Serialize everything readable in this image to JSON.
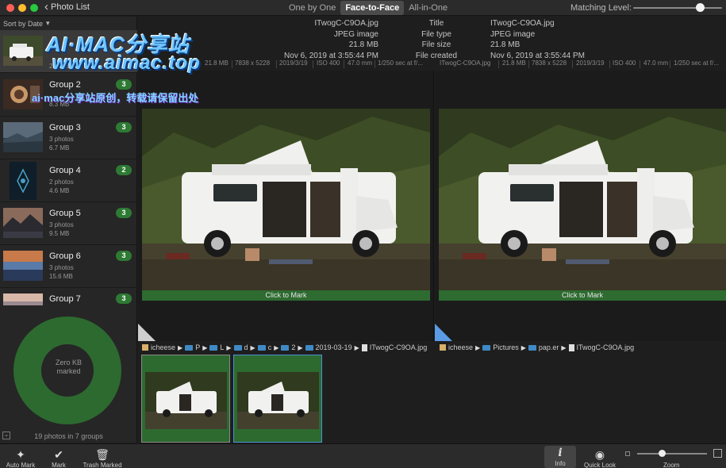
{
  "titlebar": {
    "back_label": "Photo List",
    "tabs": [
      "One by One",
      "Face-to-Face",
      "All-in-One"
    ],
    "active_tab": "Face-to-Face",
    "matching_label": "Matching Level:",
    "matching_level": 0.75,
    "traffic_colors": [
      "#fe5f57",
      "#febc2e",
      "#28c840"
    ]
  },
  "sidebar": {
    "sort_label": "Sort by Date",
    "groups": [
      {
        "name": "",
        "photos": "2 photos",
        "size": ""
      },
      {
        "name": "Group 2",
        "badge": "3",
        "photos": "",
        "size": "8.3 MB"
      },
      {
        "name": "Group 3",
        "badge": "3",
        "photos": "3 photos",
        "size": "6.7 MB"
      },
      {
        "name": "Group 4",
        "badge": "2",
        "photos": "2 photos",
        "size": "4.6 MB"
      },
      {
        "name": "Group 5",
        "badge": "3",
        "photos": "3 photos",
        "size": "9.5 MB"
      },
      {
        "name": "Group 6",
        "badge": "3",
        "photos": "3 photos",
        "size": "15.6 MB"
      },
      {
        "name": "Group 7",
        "badge": "3",
        "photos": "",
        "size": ""
      }
    ],
    "donut_line1": "Zero KB",
    "donut_line2": "marked",
    "summary": "19 photos in 7 groups"
  },
  "info": {
    "left": {
      "title": "ITwogC-C9OA.jpg",
      "type": "JPEG image",
      "size": "21.8 MB",
      "created": "Nov 6, 2019 at 3:55:44 PM"
    },
    "labels": {
      "title": "Title",
      "type": "File type",
      "size": "File size",
      "created": "File created"
    },
    "right": {
      "title": "ITwogC-C9OA.jpg",
      "type": "JPEG image",
      "size": "21.8 MB",
      "created": "Nov 6, 2019 at 3:55:44 PM"
    }
  },
  "metabar": {
    "left": [
      "21.8 MB",
      "7838 x 5228",
      "2019/3/19",
      "ISO 400",
      "47.0 mm",
      "1/250 sec at f/..."
    ],
    "right": [
      "ITwogC-C9OA.jpg",
      "21.8 MB",
      "7838 x 5228",
      "2019/3/19",
      "ISO 400",
      "47.0 mm",
      "1/250 sec at f/..."
    ]
  },
  "viewers": {
    "click_to_mark": "Click to Mark"
  },
  "path_left": [
    "icheese",
    "P",
    "L",
    "d",
    "c",
    "2",
    "2019-03-19",
    "ITwogC-C9OA.jpg"
  ],
  "path_right": [
    "icheese",
    "Pictures",
    "pap.er",
    "ITwogC-C9OA.jpg"
  ],
  "toolbar": {
    "auto_mark": "Auto Mark",
    "mark": "Mark",
    "trash_marked": "Trash Marked",
    "info": "Info",
    "quick_look": "Quick Look",
    "zoom": "Zoom",
    "zoom_level": 0.35
  },
  "watermark": {
    "line1": "AI·MAC分享站",
    "line2": "www.aimac.top",
    "line3": "ai·mac分享站原创，转载请保留出处"
  }
}
